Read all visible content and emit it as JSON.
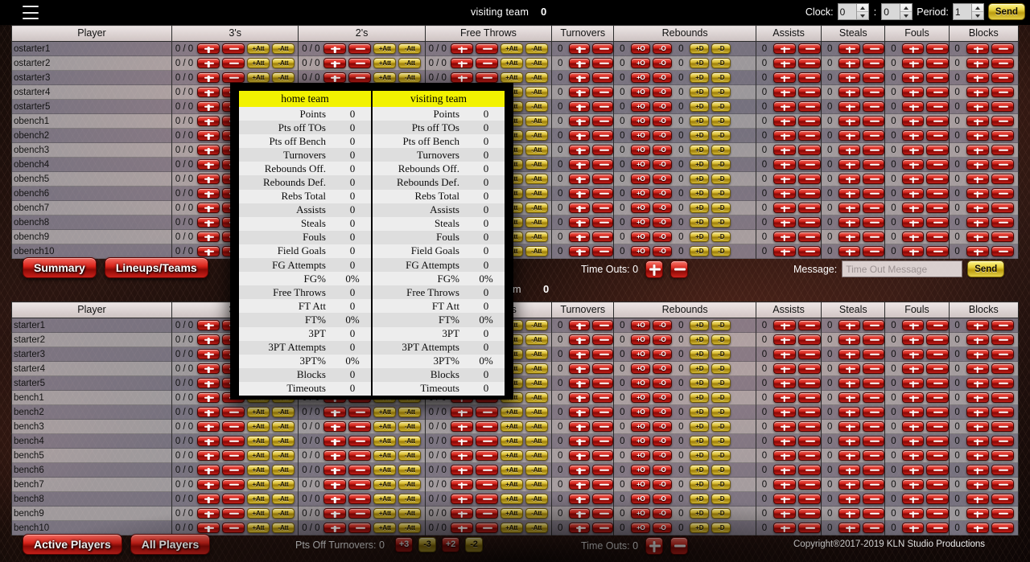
{
  "topbar": {
    "menu_icon": "hamburger-menu-icon",
    "away_team_label": "visiting team",
    "away_team_score": "0",
    "clock_label": "Clock:",
    "clock_minutes": "0",
    "clock_seconds": "0",
    "clock_separator": ":",
    "period_label": "Period:",
    "period_value": "1",
    "send_label": "Send"
  },
  "columns": [
    "Player",
    "3's",
    "2's",
    "Free Throws",
    "Turnovers",
    "Rebounds",
    "Assists",
    "Steals",
    "Fouls",
    "Blocks"
  ],
  "cell_buttons": {
    "plus": "+",
    "minus": "-",
    "att_plus": "+Att",
    "att_minus": "-Att",
    "oreb_plus": "+O",
    "oreb_minus": "-O",
    "dreb_plus": "+D",
    "dreb_minus": "-D"
  },
  "cell_defaults": {
    "made_attempted": "0 / 0",
    "count": "0"
  },
  "away_table": {
    "players": [
      "ostarter1",
      "ostarter2",
      "ostarter3",
      "ostarter4",
      "ostarter5",
      "obench1",
      "obench2",
      "obench3",
      "obench4",
      "obench5",
      "obench6",
      "obench7",
      "obench8",
      "obench9",
      "obench10"
    ]
  },
  "home_table": {
    "players": [
      "starter1",
      "starter2",
      "starter3",
      "starter4",
      "starter5",
      "bench1",
      "bench2",
      "bench3",
      "bench4",
      "bench5",
      "bench6",
      "bench7",
      "bench8",
      "bench9",
      "bench10"
    ]
  },
  "away_controls": {
    "summary_label": "Summary",
    "lineups_label": "Lineups/Teams",
    "timeouts_label": "Time Outs: 0",
    "message_label": "Message:",
    "message_value": "",
    "message_placeholder": "Time Out Message",
    "send_label": "Send"
  },
  "mid_row": {
    "home_team_label": "home team",
    "home_team_score": "0"
  },
  "home_controls": {
    "active_players_label": "Active Players",
    "all_players_label": "All Players",
    "pts_off_turnovers_label": "Pts Off Turnovers: 0",
    "pot_plus3": "+3",
    "pot_minus3": "-3",
    "pot_plus2": "+2",
    "pot_minus2": "-2",
    "timeouts_label": "Time Outs: 0",
    "copyright": "Copyright®2017-2019 KLN Studio Productions"
  },
  "modal": {
    "home_header": "home team",
    "visiting_header": "visiting team",
    "rows": [
      {
        "label": "Points",
        "home": "0",
        "visiting": "0"
      },
      {
        "label": "Pts off TOs",
        "home": "0",
        "visiting": "0"
      },
      {
        "label": "Pts off Bench",
        "home": "0",
        "visiting": "0"
      },
      {
        "label": "Turnovers",
        "home": "0",
        "visiting": "0"
      },
      {
        "label": "Rebounds Off.",
        "home": "0",
        "visiting": "0"
      },
      {
        "label": "Rebounds Def.",
        "home": "0",
        "visiting": "0"
      },
      {
        "label": "Rebs Total",
        "home": "0",
        "visiting": "0"
      },
      {
        "label": "Assists",
        "home": "0",
        "visiting": "0"
      },
      {
        "label": "Steals",
        "home": "0",
        "visiting": "0"
      },
      {
        "label": "Fouls",
        "home": "0",
        "visiting": "0"
      },
      {
        "label": "Field Goals",
        "home": "0",
        "visiting": "0"
      },
      {
        "label": "FG Attempts",
        "home": "0",
        "visiting": "0"
      },
      {
        "label": "FG%",
        "home": "0%",
        "visiting": "0%"
      },
      {
        "label": "Free Throws",
        "home": "0",
        "visiting": "0"
      },
      {
        "label": "FT Att",
        "home": "0",
        "visiting": "0"
      },
      {
        "label": "FT%",
        "home": "0%",
        "visiting": "0%"
      },
      {
        "label": "3PT",
        "home": "0",
        "visiting": "0"
      },
      {
        "label": "3PT Attempts",
        "home": "0",
        "visiting": "0"
      },
      {
        "label": "3PT%",
        "home": "0%",
        "visiting": "0%"
      },
      {
        "label": "Blocks",
        "home": "0",
        "visiting": "0"
      },
      {
        "label": "Timeouts",
        "home": "0",
        "visiting": "0"
      }
    ]
  },
  "colors": {
    "modal_header": "#f2f200",
    "accent_red": "#d5241b",
    "accent_gold": "#e8d23d",
    "top_bar": "#000000"
  }
}
